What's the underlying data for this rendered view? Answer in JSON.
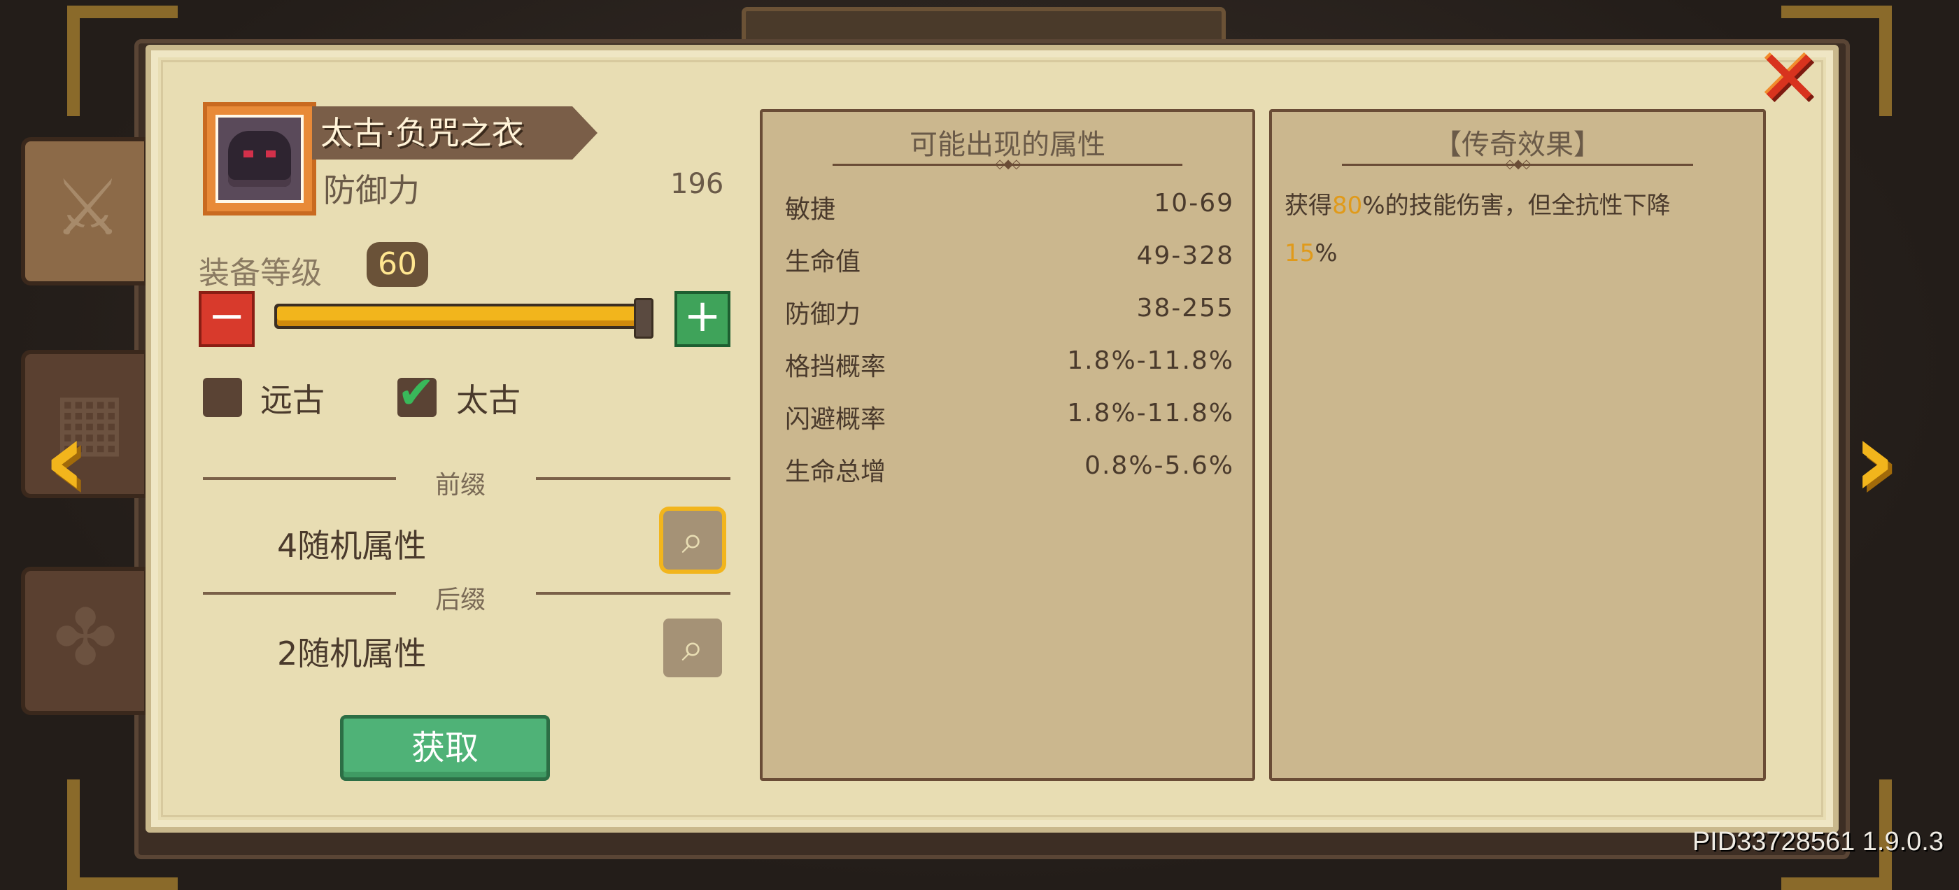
{
  "item": {
    "name": "太古·负咒之衣",
    "stat_name": "防御力",
    "stat_value": "196"
  },
  "level": {
    "label": "装备等级",
    "value": "60",
    "progress": 1.0
  },
  "tiers": [
    {
      "label": "远古",
      "checked": false
    },
    {
      "label": "太古",
      "checked": true
    }
  ],
  "prefix": {
    "label": "前缀",
    "text": "4随机属性"
  },
  "suffix": {
    "label": "后缀",
    "text": "2随机属性"
  },
  "get_button": "获取",
  "attributes": {
    "title": "可能出现的属性",
    "rows": [
      {
        "name": "敏捷",
        "range": "10-69"
      },
      {
        "name": "生命值",
        "range": "49-328"
      },
      {
        "name": "防御力",
        "range": "38-255"
      },
      {
        "name": "格挡概率",
        "range": "1.8%-11.8%"
      },
      {
        "name": "闪避概率",
        "range": "1.8%-11.8%"
      },
      {
        "name": "生命总增",
        "range": "0.8%-5.6%"
      }
    ]
  },
  "legendary": {
    "title": "【传奇效果】",
    "line1_pre": "获得",
    "line1_num": "80",
    "line1_post": "%的技能伤害，但全抗性下降",
    "line2_num": "15",
    "line2_post": "%"
  },
  "colors": {
    "accent_gold": "#f2b51c",
    "highlight_number": "#e09a1a",
    "get_button_green": "#4fb277",
    "close_red": "#d8331e"
  },
  "icons": {
    "close": "close-icon",
    "prev": "chevron-left-icon",
    "next": "chevron-right-icon",
    "magnifier": "magnifier-icon"
  },
  "footer": {
    "pid": "PID33728561 1.9.0.3"
  }
}
